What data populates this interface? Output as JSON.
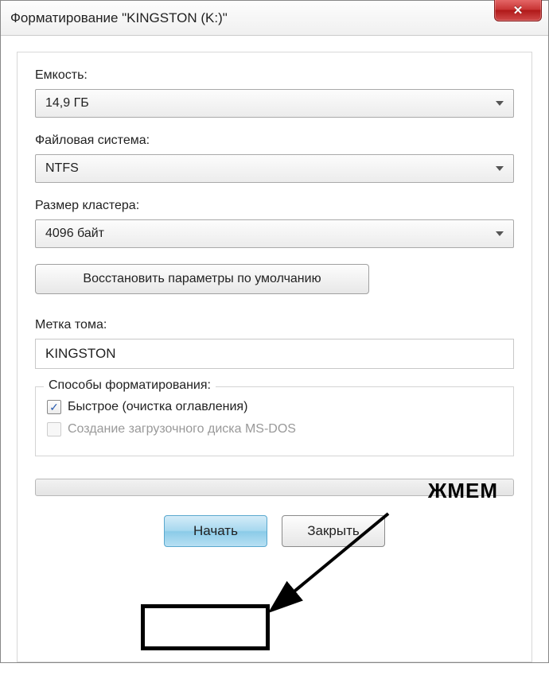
{
  "window": {
    "title": "Форматирование \"KINGSTON (K:)\""
  },
  "fields": {
    "capacity_label": "Емкость:",
    "capacity_value": "14,9 ГБ",
    "filesystem_label": "Файловая система:",
    "filesystem_value": "NTFS",
    "cluster_label": "Размер кластера:",
    "cluster_value": "4096 байт",
    "restore_defaults": "Восстановить параметры по умолчанию",
    "volume_label_label": "Метка тома:",
    "volume_label_value": "KINGSTON"
  },
  "format_options": {
    "group_title": "Способы форматирования:",
    "quick_format": "Быстрое (очистка оглавления)",
    "quick_format_checked": true,
    "msdos_boot": "Создание загрузочного диска MS-DOS",
    "msdos_boot_checked": false
  },
  "buttons": {
    "start": "Начать",
    "close": "Закрыть"
  },
  "annotation": {
    "text": "ЖМЕМ"
  }
}
